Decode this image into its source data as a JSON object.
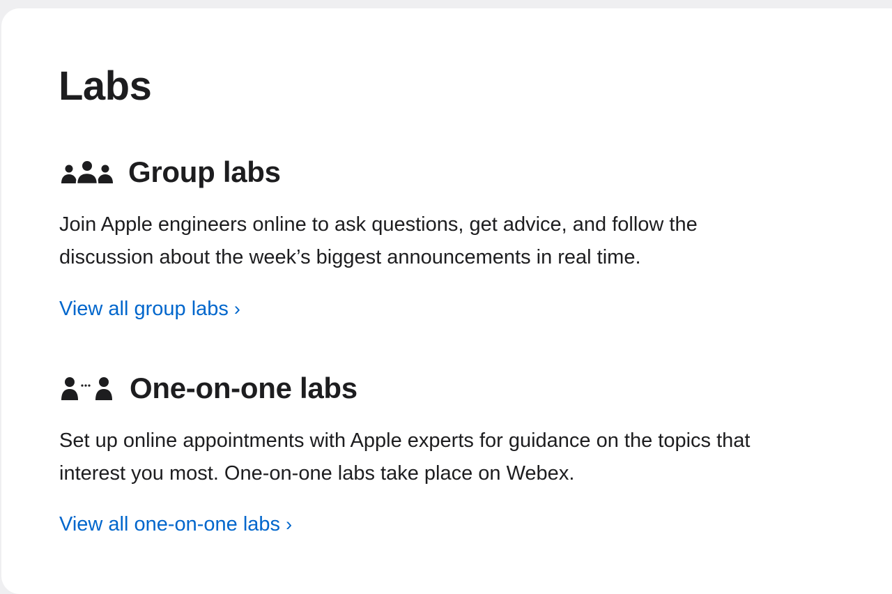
{
  "page": {
    "title": "Labs"
  },
  "sections": [
    {
      "heading": "Group labs",
      "icon": "group-people-icon",
      "description_lines": [
        "Join Apple engineers online to ask questions, get advice, and follow the",
        "discussion about the week’s biggest announcements in real time."
      ],
      "link_label": "View all group labs",
      "link_chevron": "›"
    },
    {
      "heading": "One-on-one labs",
      "icon": "one-on-one-people-icon",
      "description_lines": [
        "Set up online appointments with Apple experts for guidance on the topics that",
        "interest you most. One-on-one labs take place on Webex."
      ],
      "link_label": "View all one-on-one labs",
      "link_chevron": "›"
    }
  ],
  "colors": {
    "background": "#efeff1",
    "card": "#ffffff",
    "text": "#1d1d1f",
    "link": "#0066cc"
  }
}
